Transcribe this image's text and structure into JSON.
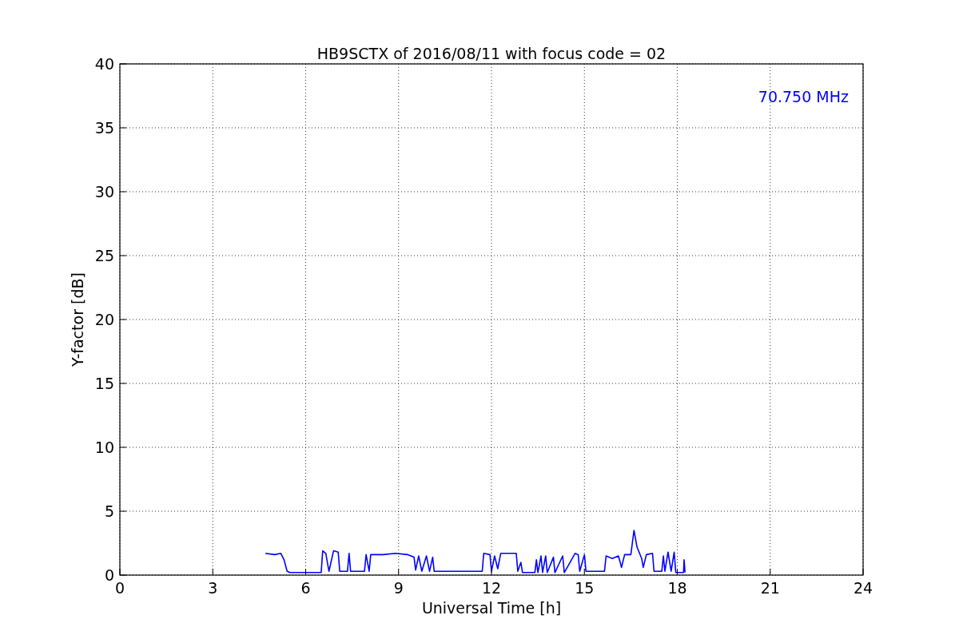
{
  "chart_data": {
    "type": "line",
    "title": "HB9SCTX of 2016/08/11 with focus code = 02",
    "xlabel": "Universal Time [h]",
    "ylabel": "Y-factor [dB]",
    "x": [
      4.7,
      5.0,
      5.2,
      5.3,
      5.4,
      5.5,
      6.0,
      6.5,
      6.55,
      6.65,
      6.75,
      6.9,
      7.05,
      7.1,
      7.35,
      7.4,
      7.45,
      7.9,
      7.95,
      8.05,
      8.1,
      8.5,
      8.9,
      9.3,
      9.5,
      9.55,
      9.65,
      9.75,
      9.9,
      10.0,
      10.1,
      10.15,
      11.0,
      11.7,
      11.75,
      11.95,
      12.0,
      12.1,
      12.2,
      12.3,
      12.8,
      12.85,
      12.95,
      13.0,
      13.4,
      13.45,
      13.5,
      13.6,
      13.65,
      13.75,
      13.8,
      14.0,
      14.05,
      14.3,
      14.35,
      14.7,
      14.8,
      14.85,
      15.0,
      15.05,
      15.65,
      15.7,
      15.9,
      16.1,
      16.2,
      16.3,
      16.5,
      16.6,
      16.7,
      16.85,
      16.9,
      17.0,
      17.2,
      17.25,
      17.5,
      17.55,
      17.6,
      17.7,
      17.8,
      17.9,
      17.95,
      18.2,
      18.22,
      18.25
    ],
    "series": [
      {
        "name": "70.750 MHz",
        "color": "#0000ff",
        "values": [
          1.7,
          1.6,
          1.7,
          1.2,
          0.3,
          0.2,
          0.2,
          0.2,
          1.9,
          1.7,
          0.3,
          1.9,
          1.8,
          0.3,
          0.3,
          1.7,
          0.3,
          0.3,
          1.6,
          0.3,
          1.6,
          1.6,
          1.7,
          1.6,
          1.4,
          0.4,
          1.5,
          0.3,
          1.5,
          0.3,
          1.4,
          0.3,
          0.3,
          0.3,
          1.7,
          1.6,
          0.3,
          1.5,
          0.5,
          1.7,
          1.7,
          0.3,
          1.0,
          0.2,
          0.2,
          1.2,
          0.2,
          1.5,
          0.2,
          1.5,
          0.2,
          1.4,
          0.2,
          1.5,
          0.2,
          1.7,
          1.6,
          0.3,
          1.6,
          0.3,
          0.3,
          1.5,
          1.3,
          1.5,
          0.6,
          1.6,
          1.6,
          3.5,
          2.2,
          1.3,
          0.6,
          1.6,
          1.7,
          0.3,
          0.3,
          1.5,
          0.3,
          1.8,
          0.3,
          1.8,
          0.2,
          0.2,
          1.2,
          0.2
        ]
      }
    ],
    "xlim": [
      0,
      24
    ],
    "ylim": [
      0,
      40
    ],
    "xticks": [
      0,
      3,
      6,
      9,
      12,
      15,
      18,
      21,
      24
    ],
    "yticks": [
      0,
      5,
      10,
      15,
      20,
      25,
      30,
      35,
      40
    ],
    "grid": true
  }
}
